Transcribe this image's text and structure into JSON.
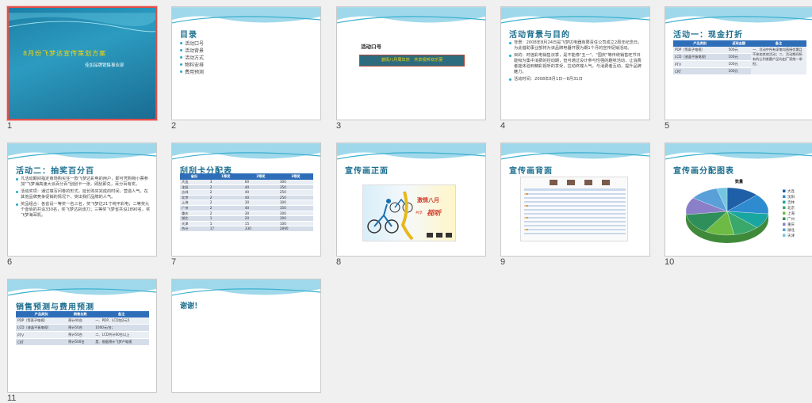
{
  "slides": [
    {
      "num": "1",
      "title": "8月份飞梦达宣传策划方案",
      "subtitle": "佳加品牌销售事业部"
    },
    {
      "num": "2",
      "title": "目录",
      "items": [
        "活动口号",
        "活动背景",
        "活动方式",
        "物料安排",
        "费用预测"
      ]
    },
    {
      "num": "3",
      "label": "活动口号",
      "slogan": "激情八月周年庆　共享视听欢乐宴"
    },
    {
      "num": "4",
      "title": "活动背景与目的",
      "items": [
        "背景：2008年8月24日是飞梦达电器有限责任公司成立2周年纪念日。为此借助事业部将为该品牌电器开展为期1个月的宣传促销活动。",
        "目的：时值彩电销售淡季，是不能像\"五一\"、\"国庆\"等传统销售旺节日能吸为集中消费的控动期，但可通过设计参与性强的趣味活动，让消费者能体验到精彩视听的享受，拉动终端人气，与消费者互动，提升品牌魅力。",
        "活动时间：2008年8月1日—8月31日"
      ]
    },
    {
      "num": "5",
      "title": "活动一：现金打折",
      "headers": [
        "产品类别",
        "返现金额",
        "备注"
      ],
      "rows": [
        [
          "PDP（等离子电视）",
          "500元",
          "一、活动中所有家电均直接优惠且不参加其他活动；"
        ],
        [
          "LCD（液晶平板电视）",
          "100元",
          "二、活动期间所有的让利差额产品均由厂家统一承担；"
        ],
        [
          "PTV",
          "100元",
          ""
        ],
        [
          "CRT",
          "100元",
          ""
        ]
      ]
    },
    {
      "num": "6",
      "title": "活动二：抽奖百分百",
      "items": [
        "凡活动期间指定商场购买任一款飞梦达彩电的用户，即可凭购物小票参加\"飞梦海高速大派百分百\"刮刮卡一张，即刮即兑，百分百有奖。",
        "活动奖项：通过填写问卷的形式，延长购买完成的时间，营造人气，在其他品牌竞争促销的情况下，突出我们品牌的人气。",
        "奖品组合：各省设一等奖一名三名，奖飞梦达21寸纯平彩电；二等奖九个壹佰的共设330名，奖飞梦达刹该刀；三等奖飞梦省共设2890名，奖飞梦海耳机。"
      ]
    },
    {
      "num": "7",
      "title": "刮刮卡分配表",
      "headers": [
        "省份",
        "1等奖",
        "2等奖",
        "3等奖"
      ],
      "rows": [
        [
          "大连",
          "3",
          "60",
          "300"
        ],
        [
          "沈阳",
          "2",
          "40",
          "350"
        ],
        [
          "吉林",
          "2",
          "40",
          "250"
        ],
        [
          "北京",
          "2",
          "40",
          "250"
        ],
        [
          "上海",
          "2",
          "30",
          "300"
        ],
        [
          "广州",
          "2",
          "40",
          "350"
        ],
        [
          "重庆",
          "2",
          "30",
          "300"
        ],
        [
          "湖北",
          "1",
          "20",
          "300"
        ],
        [
          "天津",
          "1",
          "15",
          "100"
        ],
        [
          "合计",
          "17",
          "330",
          "2890"
        ]
      ]
    },
    {
      "num": "8",
      "title": "宣传画正面",
      "poster_text": "激情八月",
      "poster_sub": "共享",
      "poster_accent": "视听"
    },
    {
      "num": "9",
      "title": "宣传画背面"
    },
    {
      "num": "10",
      "title": "宣传画分配图表",
      "chart_title": "数量",
      "legend": [
        "大连",
        "沈阳",
        "吉林",
        "北京",
        "上海",
        "广州",
        "重庆",
        "湖北",
        "天津"
      ]
    },
    {
      "num": "11",
      "title": "销售预测与费用预测",
      "headers": [
        "产品类别",
        "销售台数",
        "备注"
      ],
      "rows": [
        [
          "PDP（等离子电视）",
          "预计40台",
          "一、PDP、LCD加2元5"
        ],
        [
          "LCD（液晶平板电视）",
          "预计50台",
          "1000元/台；"
        ],
        [
          "PTV",
          "预计50台",
          "二、LCD共计60台以上"
        ],
        [
          "CRT",
          "预计500台",
          "是、根据预计飞梦产电视"
        ]
      ]
    },
    {
      "num": "12",
      "title": "谢谢！"
    }
  ],
  "chart_data": {
    "type": "pie",
    "title": "数量",
    "categories": [
      "大连",
      "沈阳",
      "吉林",
      "北京",
      "上海",
      "广州",
      "重庆",
      "湖北",
      "天津"
    ],
    "values": [
      363,
      392,
      292,
      292,
      332,
      392,
      332,
      321,
      116
    ],
    "colors": [
      "#1f5fa8",
      "#2e8bd0",
      "#1aa6a0",
      "#3aa86b",
      "#6dbb45",
      "#2f8f5a",
      "#8a7fc8",
      "#5aa0d8",
      "#74c6e0"
    ]
  }
}
